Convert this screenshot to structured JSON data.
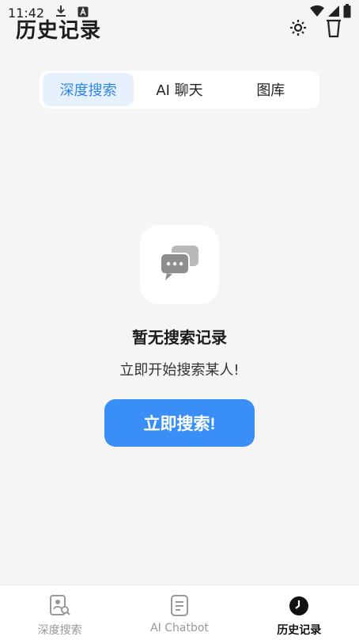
{
  "status": {
    "time": "11:42",
    "icons": [
      "download-icon",
      "app-notification-icon",
      "wifi-icon",
      "signal-icon",
      "battery-icon"
    ]
  },
  "header": {
    "title": "历史记录",
    "icons": [
      "settings-icon",
      "trash-icon"
    ]
  },
  "tabs": [
    {
      "label": "深度搜索",
      "active": true
    },
    {
      "label": "AI 聊天",
      "active": false
    },
    {
      "label": "图库",
      "active": false
    }
  ],
  "empty_state": {
    "icon": "chat-bubbles-icon",
    "title": "暂无搜索记录",
    "subtitle": "立即开始搜索某人!",
    "button_label": "立即搜索!"
  },
  "bottom_nav": [
    {
      "label": "深度搜索",
      "icon": "profile-search-icon",
      "active": false
    },
    {
      "label": "AI Chatbot",
      "icon": "document-icon",
      "active": false
    },
    {
      "label": "历史记录",
      "icon": "clock-icon",
      "active": true
    }
  ],
  "colors": {
    "accent": "#3a8ff6",
    "tab_active_bg": "#e7f1fd",
    "tab_active_text": "#2f86e6",
    "background": "#f5f5f5"
  }
}
